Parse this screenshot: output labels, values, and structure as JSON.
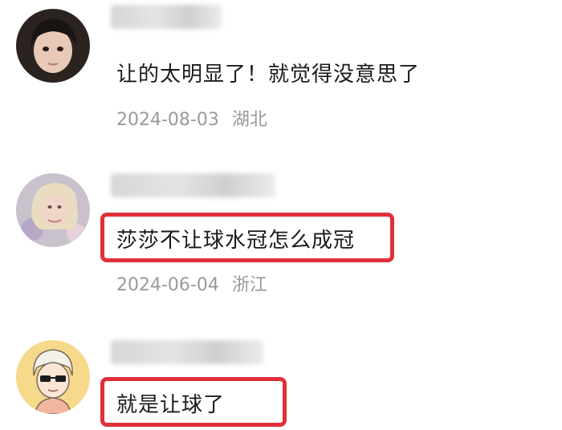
{
  "comments": [
    {
      "avatar_icon": "girl-avatar-icon",
      "text": "让的太明显了！就觉得没意思了",
      "date": "2024-08-03",
      "location": "湖北",
      "highlighted": false
    },
    {
      "avatar_icon": "blonde-woman-avatar-icon",
      "text": "莎莎不让球水冠怎么成冠",
      "date": "2024-06-04",
      "location": "浙江",
      "highlighted": true
    },
    {
      "avatar_icon": "cartoon-sunglasses-avatar-icon",
      "text": "就是让球了",
      "date": "",
      "location": "",
      "highlighted": true
    }
  ],
  "colors": {
    "highlight": "#e0303a",
    "meta_text": "#9a9a9a",
    "body_text": "#1a1a1a"
  }
}
